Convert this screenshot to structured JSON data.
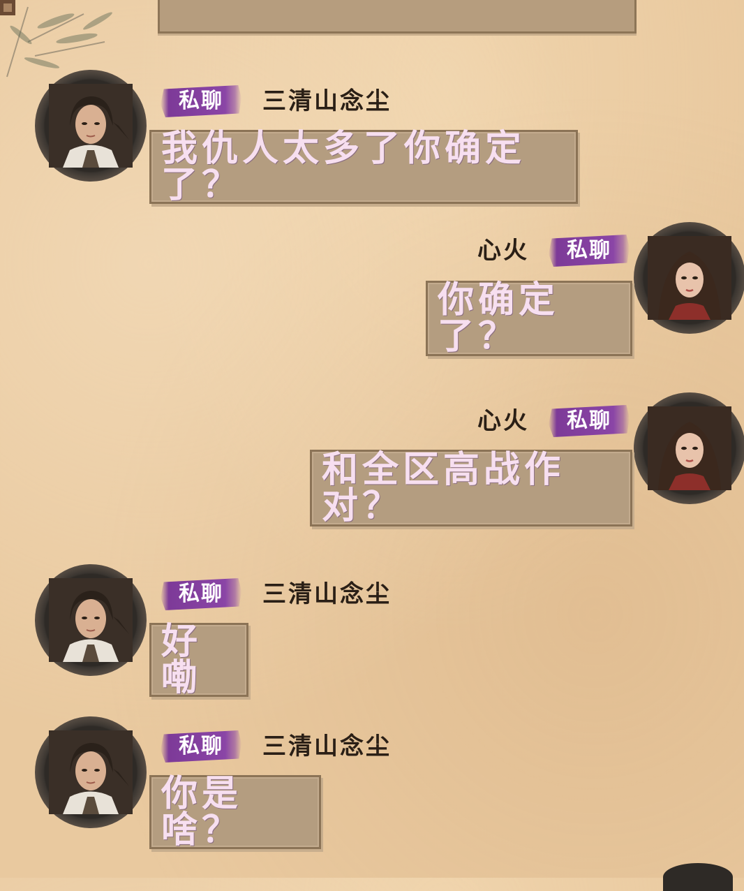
{
  "messages": [
    {
      "side": "left",
      "channel": "私聊",
      "sender": "三清山念尘",
      "text": "我仇人太多了你确定了？",
      "avatar": "male-avatar"
    },
    {
      "side": "right",
      "channel": "私聊",
      "sender": "心火",
      "text": "你确定了？",
      "avatar": "female-avatar"
    },
    {
      "side": "right",
      "channel": "私聊",
      "sender": "心火",
      "text": "和全区高战作对？",
      "avatar": "female-avatar"
    },
    {
      "side": "left",
      "channel": "私聊",
      "sender": "三清山念尘",
      "text": "好嘞",
      "avatar": "male-avatar"
    },
    {
      "side": "left",
      "channel": "私聊",
      "sender": "三清山念尘",
      "text": "你是啥？",
      "avatar": "male-avatar"
    }
  ],
  "colors": {
    "background": "#e9c99f",
    "bubble": "#b49d80",
    "bubble_text": "#f7dff0",
    "channel_tag": "#8a45a6",
    "sender_name": "#2a1f16"
  }
}
